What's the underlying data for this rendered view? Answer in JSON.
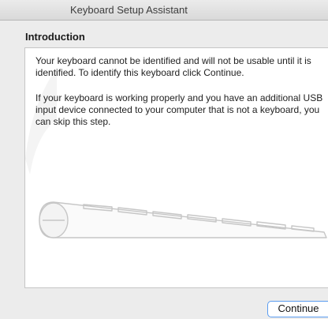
{
  "window": {
    "title": "Keyboard Setup Assistant"
  },
  "page": {
    "heading": "Introduction",
    "paragraph_1": "Your keyboard cannot be identified and will not be usable until it is identified. To identify this keyboard click Continue.",
    "paragraph_2": "If your keyboard is working properly and you have an additional USB input device connected to your computer that is not a keyboard, you can skip this step."
  },
  "illustration": {
    "icon": "wireless-keyboard-illustration"
  },
  "buttons": {
    "continue_label": "Continue"
  }
}
